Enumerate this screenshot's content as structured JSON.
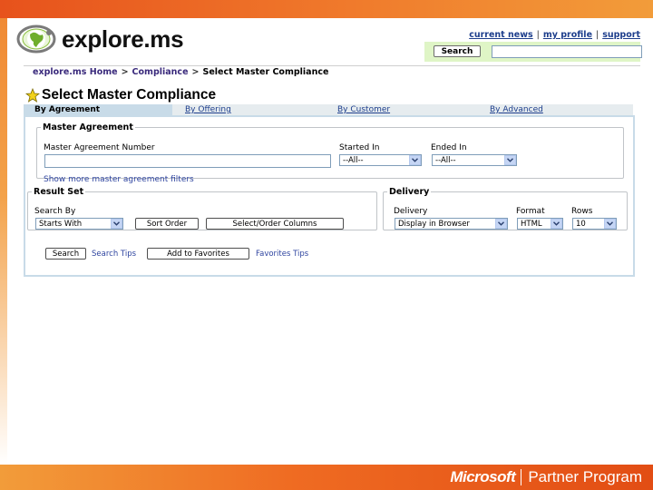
{
  "header": {
    "logo_text": "explore.ms",
    "links": [
      "current news",
      "my profile",
      "support"
    ],
    "search_button": "Search",
    "search_value": ""
  },
  "breadcrumb": [
    "explore.ms Home",
    "Compliance",
    "Select Master Compliance"
  ],
  "page_title": "Select Master Compliance",
  "tabs": [
    "By Agreement",
    "By Offering",
    "By Customer",
    "By Advanced"
  ],
  "master_agreement": {
    "legend": "Master Agreement",
    "number_label": "Master Agreement Number",
    "number_value": "",
    "started_label": "Started In",
    "started_value": "--All--",
    "ended_label": "Ended In",
    "ended_value": "--All--",
    "more_filters": "Show more master agreement filters"
  },
  "result_set": {
    "legend": "Result Set",
    "search_by_label": "Search By",
    "search_by_value": "Starts With",
    "sort_order_button": "Sort Order",
    "columns_button": "Select/Order Columns"
  },
  "delivery": {
    "legend": "Delivery",
    "delivery_label": "Delivery",
    "delivery_value": "Display in Browser",
    "format_label": "Format",
    "format_value": "HTML",
    "rows_label": "Rows",
    "rows_value": "10"
  },
  "actions": {
    "search_button": "Search",
    "search_tips": "Search Tips",
    "favorites_button": "Add to Favorites",
    "favorites_tips": "Favorites Tips"
  },
  "footer_brand": {
    "microsoft": "Microsoft",
    "program": "Partner Program"
  },
  "colors": {
    "accent_orange": "#f07b2c",
    "tab_active": "#c8dbe8",
    "search_bar_bg": "#dff5c6",
    "link_blue": "#1d3e8c"
  }
}
